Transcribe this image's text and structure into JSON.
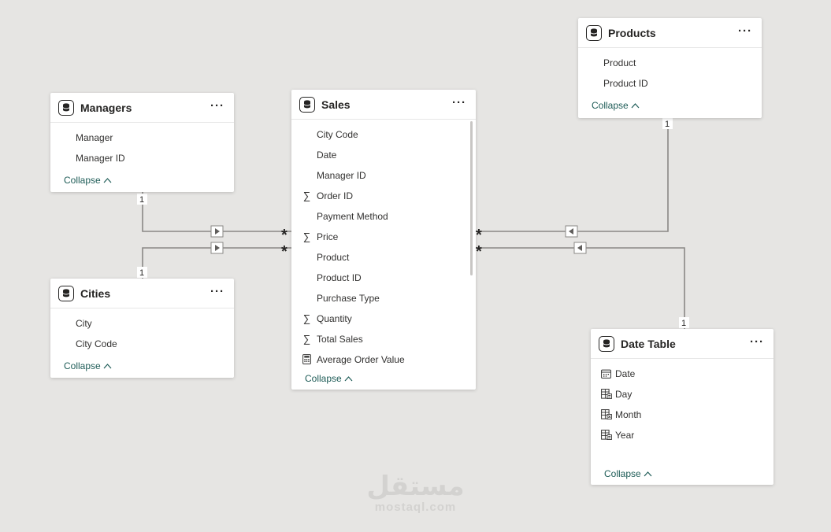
{
  "tables": {
    "managers": {
      "title": "Managers",
      "fields": [
        {
          "label": "Manager",
          "icon": "none"
        },
        {
          "label": "Manager ID",
          "icon": "none"
        }
      ],
      "collapse_label": "Collapse"
    },
    "cities": {
      "title": "Cities",
      "fields": [
        {
          "label": "City",
          "icon": "none"
        },
        {
          "label": "City Code",
          "icon": "none"
        }
      ],
      "collapse_label": "Collapse"
    },
    "sales": {
      "title": "Sales",
      "fields": [
        {
          "label": "City Code",
          "icon": "none"
        },
        {
          "label": "Date",
          "icon": "none"
        },
        {
          "label": "Manager ID",
          "icon": "none"
        },
        {
          "label": "Order ID",
          "icon": "sigma-icon"
        },
        {
          "label": "Payment Method",
          "icon": "none"
        },
        {
          "label": "Price",
          "icon": "sigma-icon"
        },
        {
          "label": "Product",
          "icon": "none"
        },
        {
          "label": "Product ID",
          "icon": "none"
        },
        {
          "label": "Purchase Type",
          "icon": "none"
        },
        {
          "label": "Quantity",
          "icon": "sigma-icon"
        },
        {
          "label": "Total Sales",
          "icon": "sigma-icon"
        },
        {
          "label": "Average Order Value",
          "icon": "calculator-icon"
        }
      ],
      "collapse_label": "Collapse"
    },
    "products": {
      "title": "Products",
      "fields": [
        {
          "label": "Product",
          "icon": "none"
        },
        {
          "label": "Product ID",
          "icon": "none"
        }
      ],
      "collapse_label": "Collapse"
    },
    "date_table": {
      "title": "Date Table",
      "fields": [
        {
          "label": "Date",
          "icon": "calendar-icon"
        },
        {
          "label": "Day",
          "icon": "calculated-column-icon"
        },
        {
          "label": "Month",
          "icon": "calculated-column-x-icon"
        },
        {
          "label": "Year",
          "icon": "calculated-column-icon"
        }
      ],
      "collapse_label": "Collapse"
    }
  },
  "relationships": {
    "one_label": "1",
    "many_label": "*"
  },
  "watermark": {
    "arabic": "مستقل",
    "latin": "mostaql.com"
  },
  "colors": {
    "background": "#e6e5e3",
    "line": "#8a8886",
    "accent": "#1e5c57"
  }
}
